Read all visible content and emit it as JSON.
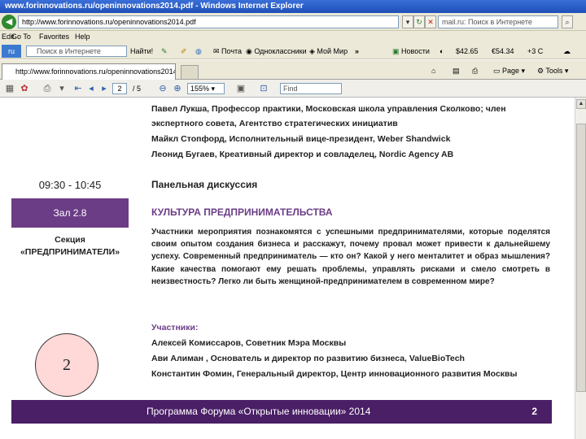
{
  "window": {
    "title": "www.forinnovations.ru/openinnovations2014.pdf - Windows Internet Explorer"
  },
  "address_bar": {
    "url": "http://www.forinnovations.ru/openinnovations2014.pdf",
    "search_placeholder": "mail.ru: Поиск в Интернете"
  },
  "menu": {
    "items": [
      "Edit",
      "Go To",
      "Favorites",
      "Help"
    ]
  },
  "toolbar": {
    "search_placeholder": "Поиск в Интернете",
    "find_label": "Найти!",
    "items": [
      "Почта",
      "Одноклассники",
      "Мой Мир",
      "»"
    ],
    "weather": "Новости",
    "currency1": "$42.65",
    "currency2": "€54.34",
    "temperature": "+3 C"
  },
  "tab": {
    "label": "http://www.forinnovations.ru/openinnovations2014.pdf"
  },
  "command_bar": {
    "page_label": "Page",
    "tools_label": "Tools"
  },
  "pdf_toolbar": {
    "page_current": "2",
    "page_total": "/ 5",
    "zoom": "155%",
    "find_placeholder": "Find"
  },
  "document": {
    "speakers_top": [
      "Павел Лукша, Профессор практики, Московская школа управления Сколково; член",
      "экспертного совета, Агентство стратегических инициатив",
      "Майкл Стопфорд, Исполнительный вице-президент, Weber Shandwick",
      "Леонид Бугаев, Креативный директор и совладелец, Nordic Agency AB"
    ],
    "time": "09:30 - 10:45",
    "hall": "Зал 2.8",
    "section_line1": "Секция",
    "section_line2": "«ПРЕДПРИНИМАТЕЛИ»",
    "panel_title": "Панельная дискуссия",
    "session_title": "КУЛЬТУРА ПРЕДПРИНИМАТЕЛЬСТВА",
    "description": "Участники мероприятия познакомятся с успешными предпринимателями, которые поделятся своим опытом создания бизнеса и расскажут, почему провал может привести к дальнейшему успеху. Современный предприниматель — кто он? Какой у него менталитет и образ мышления? Какие качества помогают ему решать проблемы, управлять рисками и смело смотреть в неизвестность? Легко ли быть женщиной-предпринимателем в современном мире?",
    "participants_heading": "Участники:",
    "participants": [
      "Алексей Комиссаров, Советник Мэра Москвы",
      "Ави Алиман , Основатель и директор по развитию бизнеса, ValueBioTech",
      "Константин Фомин, Генеральный директор, Центр инновационного развития Москвы"
    ],
    "slide_number": "2",
    "footer_text": "Программа Форума «Открытые инновации» 2014",
    "footer_page": "2"
  }
}
